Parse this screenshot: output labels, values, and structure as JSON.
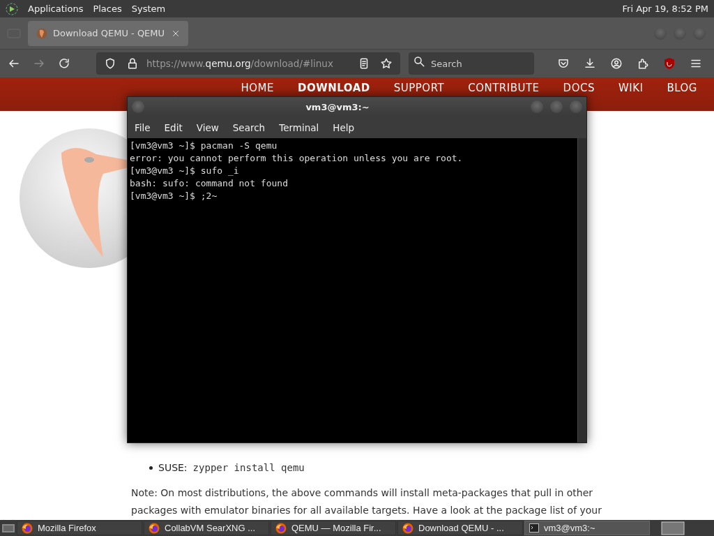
{
  "top_panel": {
    "menus": [
      "Applications",
      "Places",
      "System"
    ],
    "clock": "Fri Apr 19,  8:52 PM"
  },
  "browser": {
    "tabs": [
      {
        "title": "Download QEMU - QEMU",
        "selected": true
      }
    ],
    "address": {
      "prefix": "https://www.",
      "domain": "qemu.org",
      "path": "/download/#linux"
    },
    "search": {
      "placeholder": "Search"
    },
    "site_nav": [
      {
        "label": "HOME",
        "selected": false
      },
      {
        "label": "DOWNLOAD",
        "selected": true
      },
      {
        "label": "SUPPORT",
        "selected": false
      },
      {
        "label": "CONTRIBUTE",
        "selected": false
      },
      {
        "label": "DOCS",
        "selected": false
      },
      {
        "label": "WIKI",
        "selected": false
      },
      {
        "label": "BLOG",
        "selected": false
      }
    ],
    "content": {
      "bullet": {
        "label": "SUSE:",
        "command": "zypper install qemu"
      },
      "note_lines": [
        "Note: On most distributions, the above commands will install meta-packages that pull in other",
        "packages with emulator binaries for all available targets. Have a look at the package list of your"
      ]
    }
  },
  "terminal": {
    "title": "vm3@vm3:~",
    "menus": [
      "File",
      "Edit",
      "View",
      "Search",
      "Terminal",
      "Help"
    ],
    "lines": [
      "[vm3@vm3 ~]$ pacman -S qemu",
      "error: you cannot perform this operation unless you are root.",
      "[vm3@vm3 ~]$ sufo _i",
      "bash: sufo: command not found",
      "[vm3@vm3 ~]$ ;2~"
    ]
  },
  "taskbar": {
    "items": [
      {
        "label": "Mozilla Firefox",
        "kind": "firefox",
        "selected": false
      },
      {
        "label": "CollabVM SearXNG ...",
        "kind": "firefox",
        "selected": false
      },
      {
        "label": "QEMU — Mozilla Fir...",
        "kind": "firefox",
        "selected": false
      },
      {
        "label": "Download QEMU - ...",
        "kind": "firefox",
        "selected": false
      },
      {
        "label": "vm3@vm3:~",
        "kind": "terminal",
        "selected": true
      }
    ]
  }
}
